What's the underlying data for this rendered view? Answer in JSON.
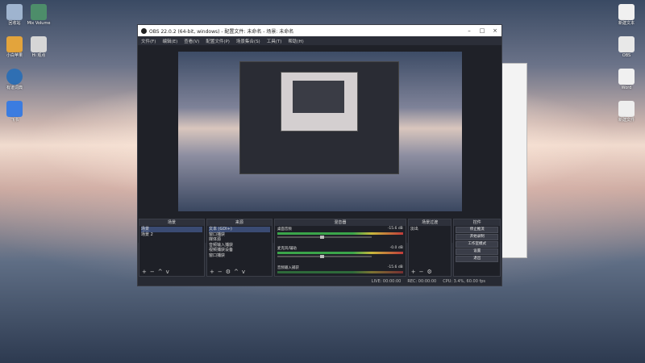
{
  "desktop": {
    "icons": [
      {
        "label": "回收站"
      },
      {
        "label": "Mix Volume"
      },
      {
        "label": "小白苹果"
      },
      {
        "label": "Hi 观点"
      },
      {
        "label": "有道词典"
      },
      {
        "label": "飞书"
      },
      {
        "label": "新建文本"
      },
      {
        "label": "OBS"
      },
      {
        "label": "Word"
      },
      {
        "label": "新建文件"
      }
    ]
  },
  "obs": {
    "title": "OBS 22.0.2 (64-bit, windows) - 配置文件: 未命名 - 场景: 未命名",
    "menu": [
      "文件(F)",
      "编辑(E)",
      "查看(V)",
      "配置文件(P)",
      "场景集合(S)",
      "工具(T)",
      "帮助(H)"
    ],
    "docks": {
      "scenes": {
        "header": "场景",
        "items": [
          "场景",
          "场景 2"
        ]
      },
      "sources": {
        "header": "来源",
        "items": [
          "文本 (GDI+)",
          "窗口捕获",
          "媒体源",
          "音频输入捕获",
          "视频捕获设备",
          "窗口捕获"
        ]
      },
      "mixer": {
        "header": "混音器",
        "channels": [
          {
            "name": "桌面音频",
            "db": "-15.6 dB"
          },
          {
            "name": "麦克风/辅助",
            "db": "-0.0 dB"
          },
          {
            "name": "音频输入捕获",
            "db": "-15.6 dB"
          }
        ]
      },
      "transitions": {
        "header": "场景过渡",
        "selected": "淡出"
      },
      "controls": {
        "header": "控件",
        "buttons": [
          "停止推流",
          "开始录制",
          "工作室模式",
          "设置",
          "退出"
        ]
      }
    },
    "status": {
      "live": "LIVE: 00:00:00",
      "rec": "REC: 00:00:00",
      "cpu": "CPU: 3.4%, 60.00 fps"
    }
  }
}
